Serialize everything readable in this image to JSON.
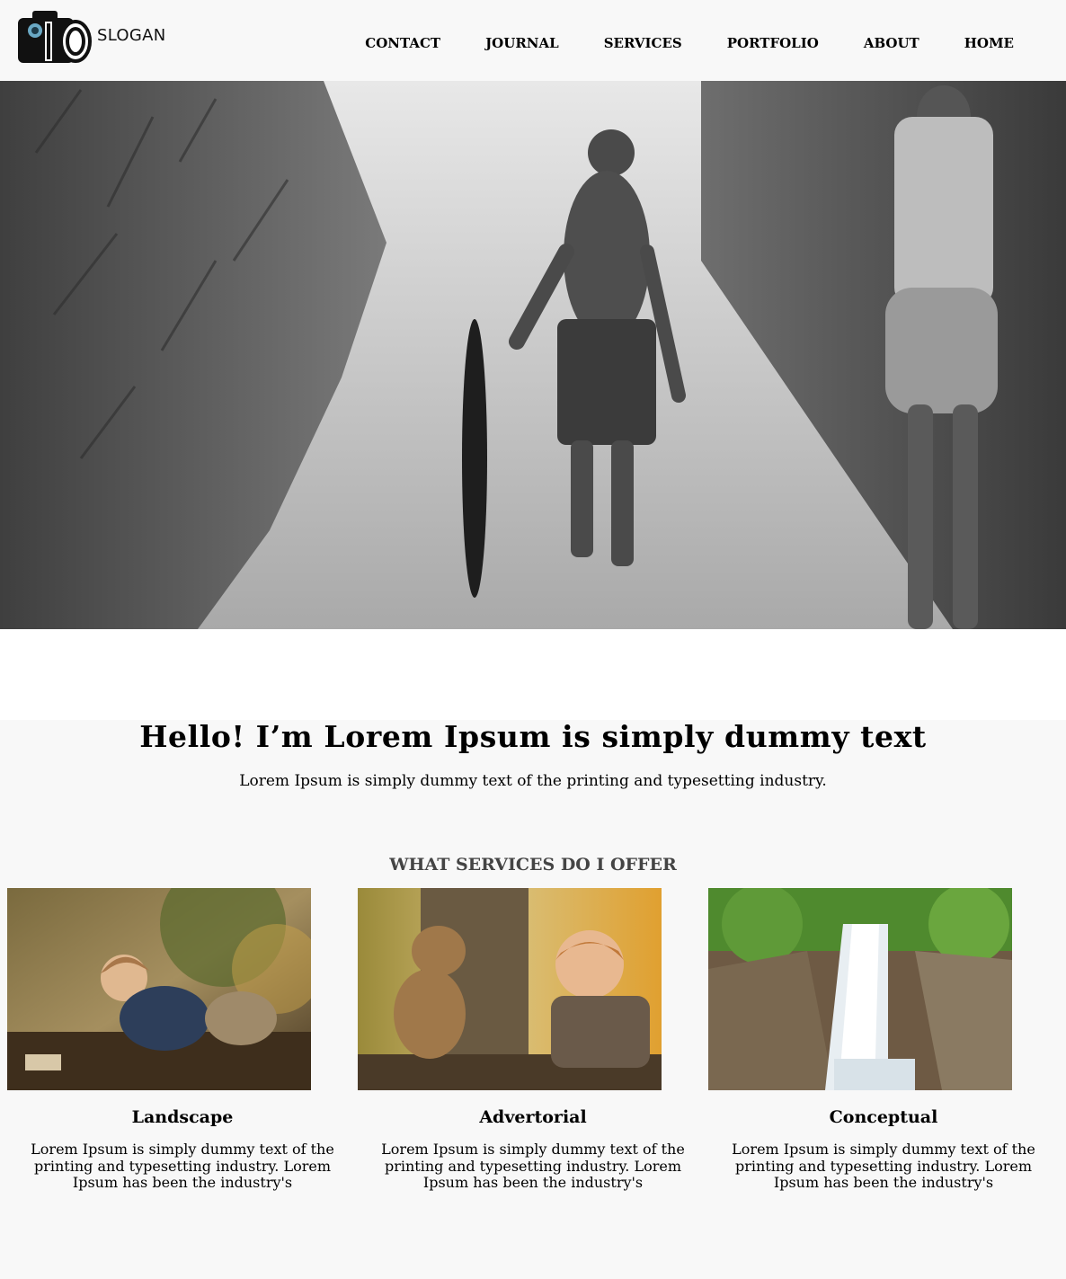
{
  "header": {
    "logo_text": "SLOGAN",
    "nav": [
      "CONTACT",
      "JOURNAL",
      "SERVICES",
      "PORTFOLIO",
      "ABOUT",
      "HOME"
    ]
  },
  "hero": {
    "image": "black-and-white photo of children running on a dirt path with a wheel"
  },
  "intro": {
    "title": "Hello! I’m Lorem Ipsum is simply dummy text",
    "subtitle": "Lorem Ipsum is simply dummy text of the printing and typesetting industry."
  },
  "services": {
    "heading": "WHAT SERVICES DO I OFFER",
    "items": [
      {
        "title": "Landscape",
        "text": "Lorem Ipsum is simply dummy text of the printing and typesetting industry. Lorem Ipsum has been the industry's",
        "image": "toddler crawling on autumn leaves"
      },
      {
        "title": "Advertorial",
        "text": "Lorem Ipsum is simply dummy text of the printing and typesetting industry. Lorem Ipsum has been the industry's",
        "image": "baby and teddy bear at a tree trunk"
      },
      {
        "title": "Conceptual",
        "text": "Lorem Ipsum is simply dummy text of the printing and typesetting industry. Lorem Ipsum has been the industry's",
        "image": "waterfall over mossy rocks"
      }
    ]
  },
  "colors": {
    "background": "#f8f8f8",
    "heading_gray": "#444444",
    "text": "#000000"
  }
}
